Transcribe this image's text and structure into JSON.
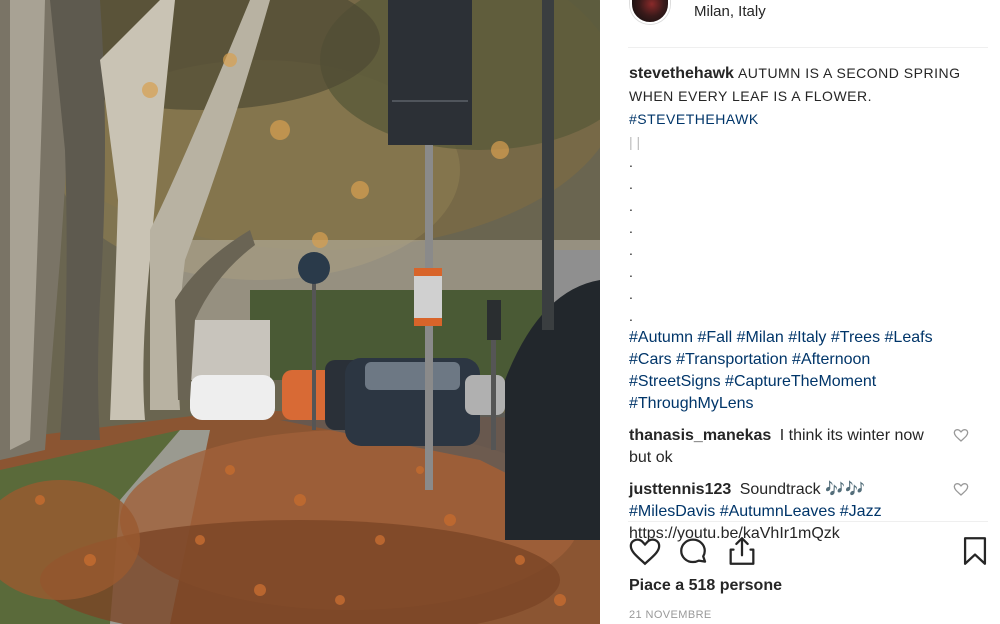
{
  "header": {
    "location": "Milan, Italy"
  },
  "caption": {
    "username": "stevethehawk",
    "text": "AUTUMN IS A SECOND SPRING WHEN EVERY LEAF IS A FLOWER.",
    "hashtag": "#STEVETHEHAWK",
    "bars": "| |",
    "dots": [
      ".",
      ".",
      ".",
      ".",
      ".",
      ".",
      ".",
      "."
    ],
    "tags_line1": "#Autumn #Fall #Milan #Italy #Trees #Leafs",
    "tags_line2": "#Cars #Transportation #Afternoon",
    "tags_line3": "#StreetSigns #CaptureTheMoment",
    "tags_line4": "#ThroughMyLens"
  },
  "comments": [
    {
      "username": "thanasis_manekas",
      "text": "I think its winter now but ok"
    },
    {
      "username": "justtennis123",
      "text": "Soundtrack 🎶🎶",
      "tags": "#MilesDavis #AutumnLeaves #Jazz",
      "link": "https://youtu.be/kaVhIr1mQzk"
    }
  ],
  "footer": {
    "likes": "Piace a 518 persone",
    "date": "21 NOVEMBRE"
  },
  "icons": {
    "like": "heart-icon",
    "comment": "comment-bubble-icon",
    "share": "share-icon",
    "save": "bookmark-icon",
    "comment_like": "heart-icon"
  }
}
